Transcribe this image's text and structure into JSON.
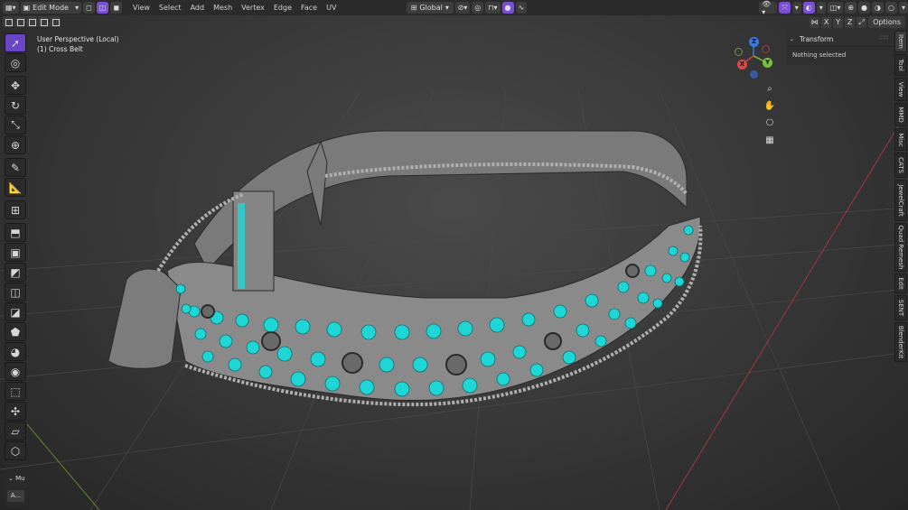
{
  "header": {
    "mode": "Edit Mode",
    "menus": [
      "View",
      "Select",
      "Add",
      "Mesh",
      "Vertex",
      "Edge",
      "Face",
      "UV"
    ],
    "transform_orientation": "Global",
    "options_label": "Options",
    "axes": [
      "X",
      "Y",
      "Z"
    ]
  },
  "overlay": {
    "view_name": "User Perspective (Local)",
    "object_name": "(1) Cross Belt"
  },
  "gizmo": {
    "z": "Z",
    "y": "Y",
    "x": "X"
  },
  "npanel": {
    "title": "Transform",
    "message": "Nothing selected"
  },
  "tabs": [
    "Item",
    "Tool",
    "View",
    "MMD",
    "Misc",
    "CATS",
    "JewelCraft",
    "Quad Remesh",
    "Edit",
    "SENT",
    "BlenderKit"
  ],
  "bottom_panel": {
    "label": "Mu",
    "button": "A..."
  },
  "colors": {
    "accent": "#7a4fd6",
    "stud": "#1fd6d6",
    "mesh": "#8a8a8a"
  }
}
